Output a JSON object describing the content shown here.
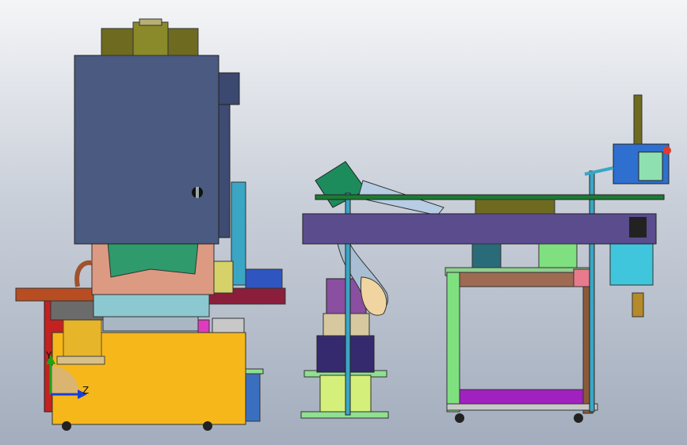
{
  "triad": {
    "y_label": "Y",
    "z_label": "Z"
  },
  "colors": {
    "housing": "#4a5a80",
    "olive": "#6e6b21",
    "yellow": "#f6b71a",
    "salmon": "#dc9a82",
    "cyan": "#8cc8d0",
    "brown": "#a24f2a",
    "purple_frame": "#5b4c8e",
    "green_cart": "#7fe07f",
    "magenta": "#a020c0",
    "red_panel": "#c42121",
    "blue_box": "#2f6fd0"
  }
}
